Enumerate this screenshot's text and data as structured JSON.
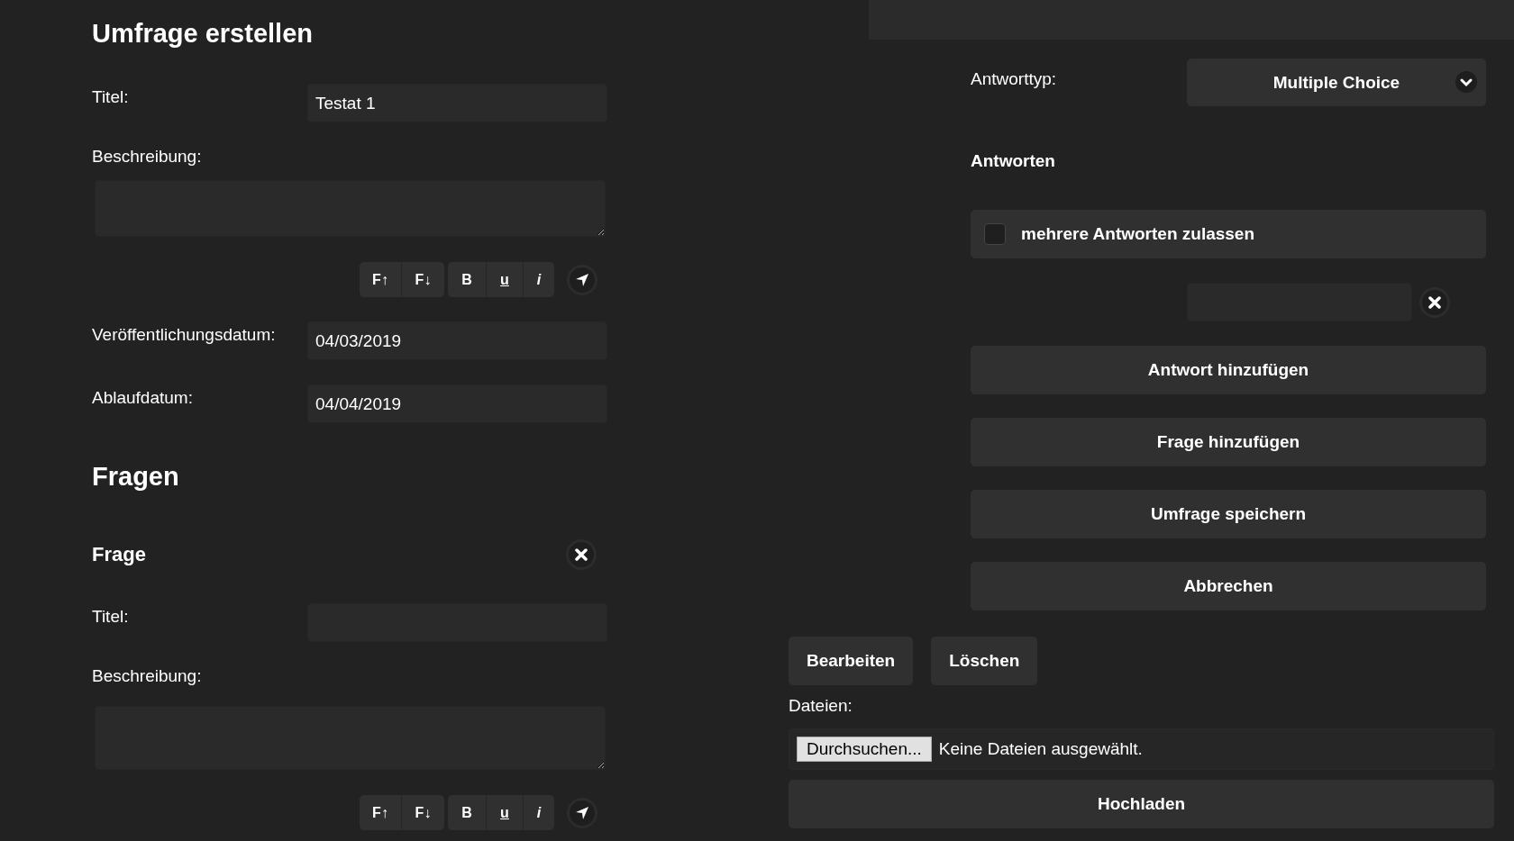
{
  "title": "Umfrage erstellen",
  "survey": {
    "title_label": "Titel:",
    "title_value": "Testat 1",
    "description_label": "Beschreibung:",
    "toolbar": [
      [
        {
          "label": "F↑",
          "kind": "plain"
        },
        {
          "label": "F↓",
          "kind": "plain"
        }
      ],
      [
        {
          "label": "B",
          "kind": "bold"
        },
        {
          "label": "u",
          "kind": "underline"
        },
        {
          "label": "i",
          "kind": "italic"
        }
      ]
    ],
    "publish_label": "Veröffentlichungsdatum:",
    "publish_value": "04/03/2019",
    "expiry_label": "Ablaufdatum:",
    "expiry_value": "04/04/2019"
  },
  "questions_heading": "Fragen",
  "question": {
    "heading": "Frage",
    "title_label": "Titel:",
    "description_label": "Beschreibung:",
    "toolbar": [
      [
        {
          "label": "F↑",
          "kind": "plain"
        },
        {
          "label": "F↓",
          "kind": "plain"
        }
      ],
      [
        {
          "label": "B",
          "kind": "bold"
        },
        {
          "label": "u",
          "kind": "underline"
        },
        {
          "label": "i",
          "kind": "italic"
        }
      ]
    ]
  },
  "answer_type": {
    "label": "Antworttyp:",
    "value": "Multiple Choice"
  },
  "answers_heading": "Antworten",
  "allow_multiple": {
    "label": "mehrere Antworten zulassen",
    "checked": false
  },
  "actions": [
    "Antwort hinzufügen",
    "Frage hinzufügen",
    "Umfrage speichern",
    "Abbrechen"
  ],
  "edit_buttons": [
    "Bearbeiten",
    "Löschen"
  ],
  "files": {
    "label": "Dateien:",
    "browse_button": "Durchsuchen...",
    "status": "Keine Dateien ausgewählt."
  },
  "upload_button": "Hochladen"
}
